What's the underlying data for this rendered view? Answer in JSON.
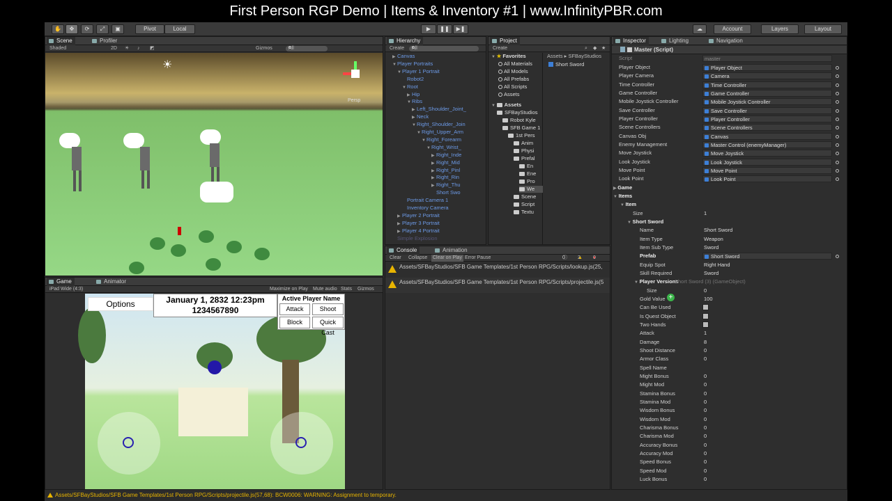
{
  "video_title": "First Person RGP Demo | Items & Inventory #1 | www.InfinityPBR.com",
  "toolbar": {
    "pivot": "Pivot",
    "local": "Local",
    "account": "Account",
    "layers": "Layers",
    "layout": "Layout"
  },
  "scene": {
    "tabs": [
      "Scene",
      "Profiler"
    ],
    "shaded": "Shaded",
    "mode_2d": "2D",
    "gizmos": "Gizmos",
    "search_all": "All",
    "persp": "Persp"
  },
  "game": {
    "tabs": [
      "Game",
      "Animator"
    ],
    "aspect": "iPad Wide (4:3)",
    "maximize": "Maximize on Play",
    "mute": "Mute audio",
    "stats": "Stats",
    "gizmos": "Gizmos",
    "options": "Options",
    "date": "January 1, 2832 12:23pm",
    "number": "1234567890",
    "active_player": "Active Player Name",
    "attack": "Attack",
    "shoot": "Shoot",
    "block": "Block",
    "quick_cast": "Quick Cast"
  },
  "hierarchy": {
    "tab": "Hierarchy",
    "create": "Create",
    "search": "All",
    "rows": [
      {
        "label": "Canvas",
        "indent": 0,
        "arrow": "▶"
      },
      {
        "label": "Player Portraits",
        "indent": 0,
        "arrow": "▼"
      },
      {
        "label": "Player 1 Portrait",
        "indent": 1,
        "arrow": "▼"
      },
      {
        "label": "Robot2",
        "indent": 2,
        "arrow": ""
      },
      {
        "label": "Root",
        "indent": 2,
        "arrow": "▼"
      },
      {
        "label": "Hip",
        "indent": 3,
        "arrow": "▶"
      },
      {
        "label": "Ribs",
        "indent": 3,
        "arrow": "▼"
      },
      {
        "label": "Left_Shoulder_Joint_",
        "indent": 4,
        "arrow": "▶"
      },
      {
        "label": "Neck",
        "indent": 4,
        "arrow": "▶"
      },
      {
        "label": "Right_Shoulder_Join",
        "indent": 4,
        "arrow": "▼"
      },
      {
        "label": "Right_Upper_Arm",
        "indent": 5,
        "arrow": "▼"
      },
      {
        "label": "Right_Forearm",
        "indent": 6,
        "arrow": "▼"
      },
      {
        "label": "Right_Wrist_",
        "indent": 7,
        "arrow": "▼"
      },
      {
        "label": "Right_Inde",
        "indent": 8,
        "arrow": "▶"
      },
      {
        "label": "Right_Mid",
        "indent": 8,
        "arrow": "▶"
      },
      {
        "label": "Right_Pinl",
        "indent": 8,
        "arrow": "▶"
      },
      {
        "label": "Right_Rin",
        "indent": 8,
        "arrow": "▶"
      },
      {
        "label": "Right_Thu",
        "indent": 8,
        "arrow": "▶"
      },
      {
        "label": "Short Swo",
        "indent": 8,
        "arrow": ""
      },
      {
        "label": "Portrait Camera 1",
        "indent": 2,
        "arrow": ""
      },
      {
        "label": "Inventory Camera",
        "indent": 2,
        "arrow": ""
      },
      {
        "label": "Player 2 Portrait",
        "indent": 1,
        "arrow": "▶"
      },
      {
        "label": "Player 3 Portrait",
        "indent": 1,
        "arrow": "▶"
      },
      {
        "label": "Player 4 Portrait",
        "indent": 1,
        "arrow": "▶"
      },
      {
        "label": "Simple Explosion",
        "indent": 0,
        "arrow": ""
      }
    ]
  },
  "project": {
    "tab": "Project",
    "create": "Create",
    "favorites": "Favorites",
    "fav_items": [
      "All Materials",
      "All Models",
      "All Prefabs",
      "All Scripts",
      "Assets"
    ],
    "assets_root": "Assets",
    "tree": [
      {
        "label": "SFBayStudios",
        "indent": 1
      },
      {
        "label": "Robot Kyle",
        "indent": 2
      },
      {
        "label": "SFB Game 1",
        "indent": 2
      },
      {
        "label": "1st Pers",
        "indent": 3
      },
      {
        "label": "Anim",
        "indent": 4
      },
      {
        "label": "Physi",
        "indent": 4
      },
      {
        "label": "Prefal",
        "indent": 4
      },
      {
        "label": "En",
        "indent": 5
      },
      {
        "label": "Ene",
        "indent": 5
      },
      {
        "label": "Pro",
        "indent": 5
      },
      {
        "label": "We",
        "indent": 5
      },
      {
        "label": "Scene",
        "indent": 4
      },
      {
        "label": "Script",
        "indent": 4
      },
      {
        "label": "Textu",
        "indent": 4
      }
    ],
    "breadcrumb": [
      "Assets",
      "SFBayStudios"
    ],
    "selected": "Short Sword"
  },
  "console": {
    "tabs": [
      "Console",
      "Animation"
    ],
    "clear": "Clear",
    "collapse": "Collapse",
    "clear_on_play": "Clear on Play",
    "error_pause": "Error Pause",
    "count_info": "0",
    "count_warn": "2",
    "count_err": "0",
    "entries": [
      "Assets/SFBayStudios/SFB Game Templates/1st Person RPG/Scripts/lookup.js(25,",
      "Assets/SFBayStudios/SFB Game Templates/1st Person RPG/Scripts/projectile.js(5"
    ]
  },
  "inspector": {
    "tabs": [
      "Inspector",
      "Lighting",
      "Navigation"
    ],
    "component": "Master (Script)",
    "script_label": "Script",
    "script_value": "master",
    "rows": [
      {
        "label": "Player Object",
        "value": "Player Object",
        "type": "obj",
        "indent": 0
      },
      {
        "label": "Player Camera",
        "value": "Camera",
        "type": "obj",
        "indent": 0
      },
      {
        "label": "Time Controller",
        "value": "Time Controller",
        "type": "obj",
        "indent": 0
      },
      {
        "label": "Game Controller",
        "value": "Game Controller",
        "type": "obj",
        "indent": 0
      },
      {
        "label": "Mobile Joystick Controller",
        "value": "Mobile Joystick Controller",
        "type": "obj",
        "indent": 0
      },
      {
        "label": "Save Controller",
        "value": "Save Controller",
        "type": "obj",
        "indent": 0
      },
      {
        "label": "Player Controller",
        "value": "Player Controller",
        "type": "obj",
        "indent": 0
      },
      {
        "label": "Scene Controllers",
        "value": "Scene Controllers",
        "type": "obj",
        "indent": 0
      },
      {
        "label": "Canvas Obj",
        "value": "Canvas",
        "type": "obj",
        "indent": 0
      },
      {
        "label": "Enemy Management",
        "value": "Master Control (enemyManager)",
        "type": "obj",
        "indent": 0
      },
      {
        "label": "Move Joystick",
        "value": "Move Joystick",
        "type": "obj",
        "indent": 0
      },
      {
        "label": "Look Joystick",
        "value": "Look Joystick",
        "type": "obj",
        "indent": 0
      },
      {
        "label": "Move Point",
        "value": "Move Point",
        "type": "obj",
        "indent": 0
      },
      {
        "label": "Look Point",
        "value": "Look Point",
        "type": "obj",
        "indent": 0
      },
      {
        "label": "Game",
        "value": "",
        "type": "fold",
        "indent": 0,
        "arrow": "▶"
      },
      {
        "label": "Items",
        "value": "",
        "type": "fold",
        "indent": 0,
        "arrow": "▼"
      },
      {
        "label": "Item",
        "value": "",
        "type": "fold",
        "indent": 1,
        "arrow": "▼"
      },
      {
        "label": "Size",
        "value": "1",
        "type": "text",
        "indent": 2
      },
      {
        "label": "Short Sword",
        "value": "",
        "type": "fold",
        "indent": 2,
        "arrow": "▼"
      },
      {
        "label": "Name",
        "value": "Short Sword",
        "type": "text",
        "indent": 3
      },
      {
        "label": "Item Type",
        "value": "Weapon",
        "type": "text",
        "indent": 3
      },
      {
        "label": "Item Sub Type",
        "value": "Sword",
        "type": "text",
        "indent": 3
      },
      {
        "label": "Prefab",
        "value": "Short Sword",
        "type": "obj",
        "indent": 3,
        "bold": true
      },
      {
        "label": "Equip Spot",
        "value": "Right Hand",
        "type": "text",
        "indent": 3
      },
      {
        "label": "Skill Required",
        "value": "Sword",
        "type": "text",
        "indent": 3
      },
      {
        "label": "Player Versions",
        "value": "Short Sword (3) (GameObject)",
        "type": "fold",
        "indent": 3,
        "arrow": "▼"
      },
      {
        "label": "Size",
        "value": "0",
        "type": "text",
        "indent": 4
      },
      {
        "label": "Gold Value",
        "value": "100",
        "type": "text",
        "indent": 3
      },
      {
        "label": "Can Be Used",
        "value": "",
        "type": "check",
        "indent": 3
      },
      {
        "label": "Is Quest Object",
        "value": "",
        "type": "check",
        "indent": 3
      },
      {
        "label": "Two Hands",
        "value": "",
        "type": "check",
        "indent": 3
      },
      {
        "label": "Attack",
        "value": "1",
        "type": "text",
        "indent": 3
      },
      {
        "label": "Damage",
        "value": "8",
        "type": "text",
        "indent": 3
      },
      {
        "label": "Shoot Distance",
        "value": "0",
        "type": "text",
        "indent": 3
      },
      {
        "label": "Armor Class",
        "value": "0",
        "type": "text",
        "indent": 3
      },
      {
        "label": "Spell Name",
        "value": "",
        "type": "text",
        "indent": 3
      },
      {
        "label": "Might Bonus",
        "value": "0",
        "type": "text",
        "indent": 3
      },
      {
        "label": "Might Mod",
        "value": "0",
        "type": "text",
        "indent": 3
      },
      {
        "label": "Stamina Bonus",
        "value": "0",
        "type": "text",
        "indent": 3
      },
      {
        "label": "Stamina Mod",
        "value": "0",
        "type": "text",
        "indent": 3
      },
      {
        "label": "Wisdom Bonus",
        "value": "0",
        "type": "text",
        "indent": 3
      },
      {
        "label": "Wisdom Mod",
        "value": "0",
        "type": "text",
        "indent": 3
      },
      {
        "label": "Charisma Bonus",
        "value": "0",
        "type": "text",
        "indent": 3
      },
      {
        "label": "Charisma Mod",
        "value": "0",
        "type": "text",
        "indent": 3
      },
      {
        "label": "Accuracy Bonus",
        "value": "0",
        "type": "text",
        "indent": 3
      },
      {
        "label": "Accuracy Mod",
        "value": "0",
        "type": "text",
        "indent": 3
      },
      {
        "label": "Speed Bonus",
        "value": "0",
        "type": "text",
        "indent": 3
      },
      {
        "label": "Speed Mod",
        "value": "0",
        "type": "text",
        "indent": 3
      },
      {
        "label": "Luck Bonus",
        "value": "0",
        "type": "text",
        "indent": 3
      }
    ]
  },
  "status": "Assets/SFBayStudios/SFB Game Templates/1st Person RPG/Scripts/projectile.js(57,68): BCW0006: WARNING: Assignment to temporary."
}
